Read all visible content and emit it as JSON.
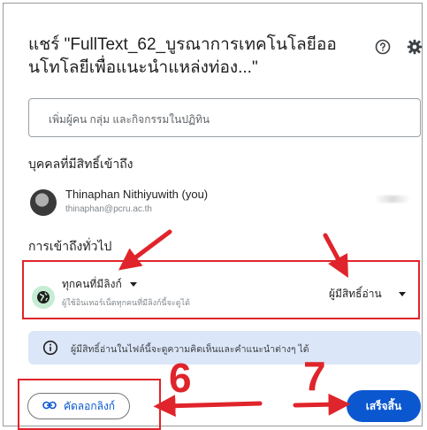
{
  "dialog": {
    "title": "แชร์ \"FullText_62_บูรณาการเทคโนโลยีออนโทโลยีเพื่อแนะนำแหล่งท่อง...\"",
    "add_people_placeholder": "เพิ่มผู้คน กลุ่ม และกิจกรรมในปฏิทิน",
    "people_with_access_label": "บุคคลที่มีสิทธิ์เข้าถึง",
    "owner": {
      "name": "Thinaphan Nithiyuwith (you)",
      "email": "thinaphan@pcru.ac.th"
    },
    "general_access_label": "การเข้าถึงทั่วไป",
    "general_access": {
      "type": "ทุกคนที่มีลิงก์",
      "description": "ผู้ใช้อินเทอร์เน็ตทุกคนที่มีลิงก์นี้จะดูได้",
      "role": "ผู้มีสิทธิ์อ่าน"
    },
    "info_message": "ผู้มีสิทธิ์อ่านในไฟล์นี้จะดูความคิดเห็นและคำแนะนำต่างๆ ได้",
    "copy_link_label": "คัดลอกลิงก์",
    "done_label": "เสร็จสิ้น"
  },
  "annotations": {
    "step_6": "6",
    "step_7": "7",
    "color": "#e0242b"
  },
  "icons": [
    "help-icon",
    "settings-icon",
    "globe-icon",
    "info-icon",
    "link-icon",
    "dropdown-arrow-icon"
  ],
  "colors": {
    "primary": "#0b57d0",
    "info_bg": "#dbe6f8",
    "globe_bg": "#c6ecd3",
    "annotation_red": "#e0242b"
  }
}
